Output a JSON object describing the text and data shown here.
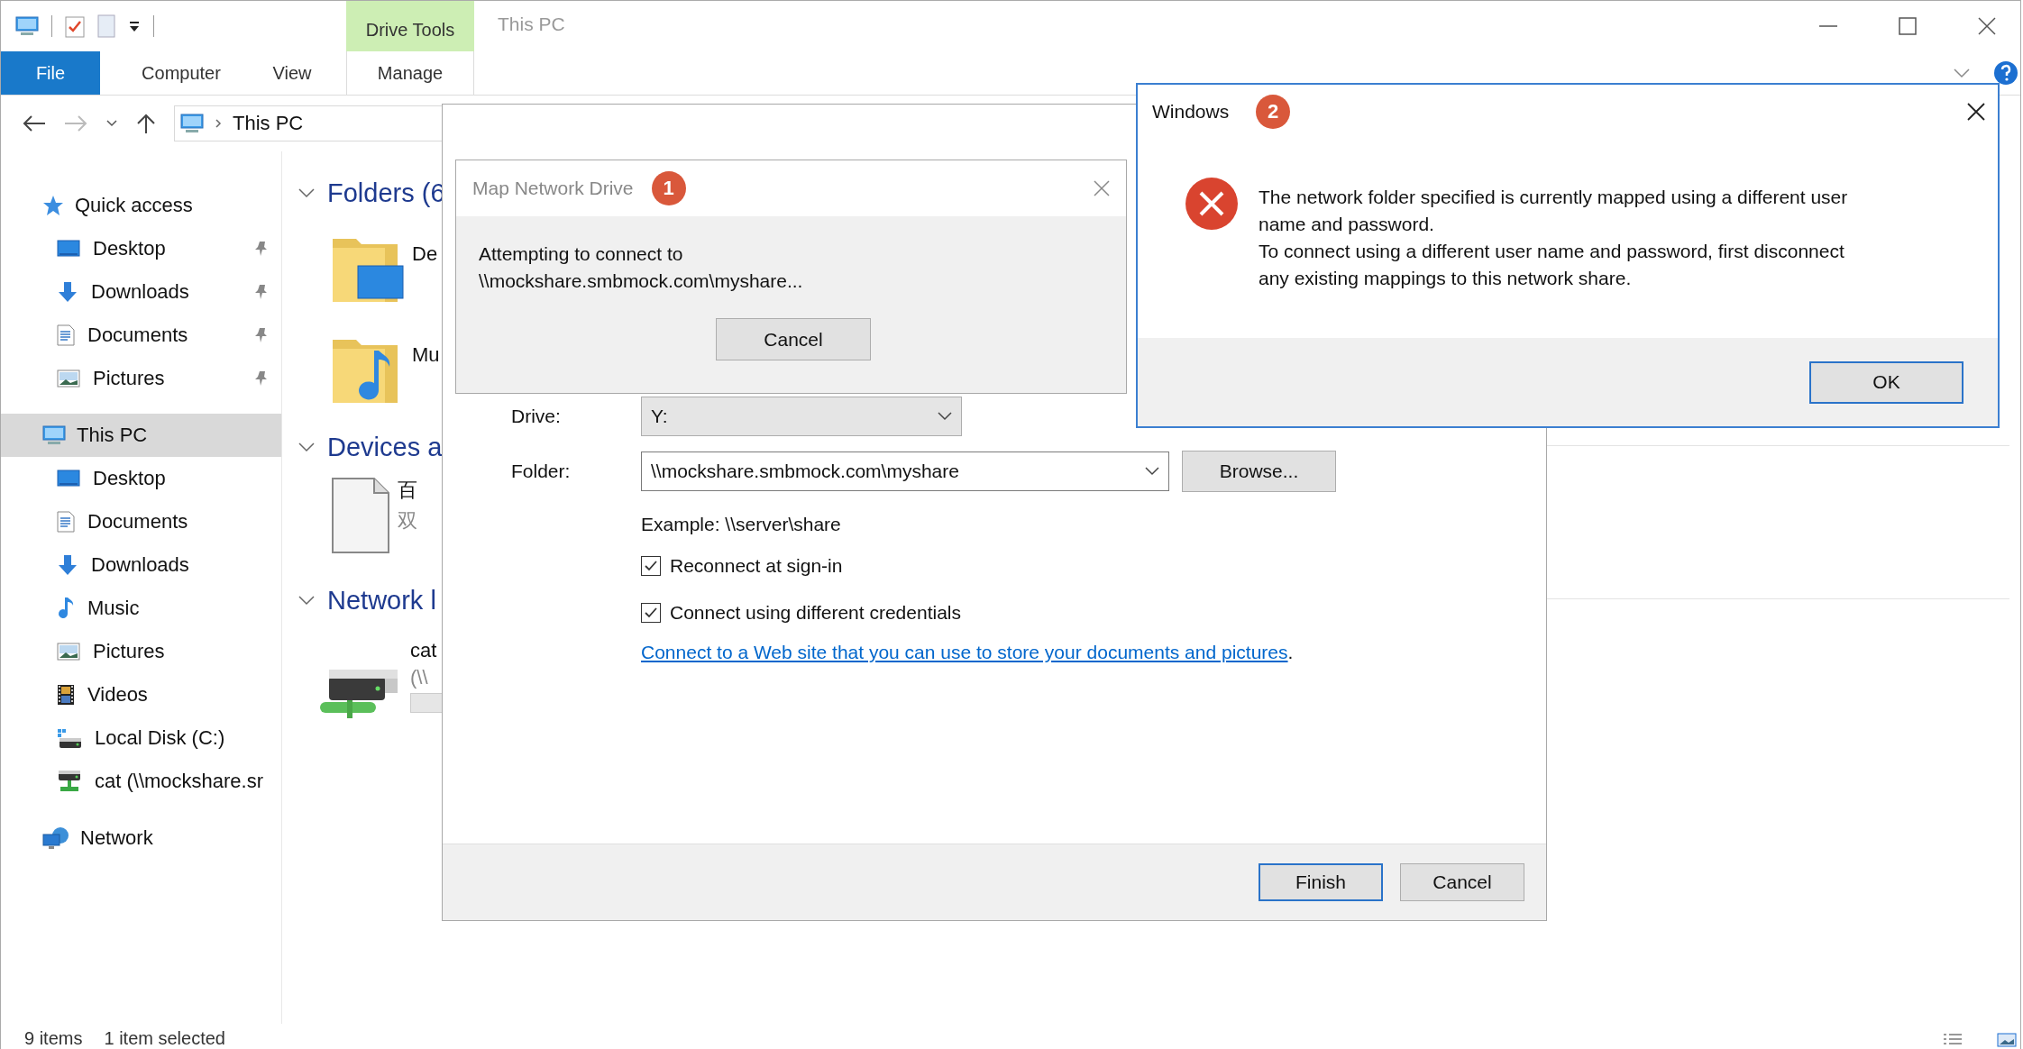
{
  "window": {
    "title": "This PC"
  },
  "contextual_tab": {
    "label": "Drive Tools"
  },
  "ribbon_tabs": [
    {
      "label": "File",
      "kind": "file"
    },
    {
      "label": "Computer",
      "kind": "tab"
    },
    {
      "label": "View",
      "kind": "tab"
    },
    {
      "label": "Manage",
      "kind": "contextual"
    }
  ],
  "address_bar": {
    "path": "This PC"
  },
  "sidebar": {
    "items": [
      {
        "label": "Quick access",
        "kind": "star",
        "selected": false,
        "children": [
          {
            "label": "Desktop",
            "kind": "desktop",
            "pinned": true
          },
          {
            "label": "Downloads",
            "kind": "downloads",
            "pinned": true
          },
          {
            "label": "Documents",
            "kind": "documents",
            "pinned": true
          },
          {
            "label": "Pictures",
            "kind": "pictures",
            "pinned": true
          }
        ]
      },
      {
        "label": "This PC",
        "kind": "pc",
        "selected": true,
        "children": [
          {
            "label": "Desktop",
            "kind": "desktop",
            "pinned": false
          },
          {
            "label": "Documents",
            "kind": "documents",
            "pinned": false
          },
          {
            "label": "Downloads",
            "kind": "downloads",
            "pinned": false
          },
          {
            "label": "Music",
            "kind": "music",
            "pinned": false
          },
          {
            "label": "Pictures",
            "kind": "pictures",
            "pinned": false
          },
          {
            "label": "Videos",
            "kind": "videos",
            "pinned": false
          },
          {
            "label": "Local Disk (C:)",
            "kind": "disk",
            "pinned": false
          },
          {
            "label": "cat (\\\\mockshare.sr",
            "kind": "netdrive",
            "pinned": false
          }
        ]
      },
      {
        "label": "Network",
        "kind": "network",
        "selected": false
      }
    ]
  },
  "content": {
    "groups": [
      {
        "title": "Folders (6",
        "items": [
          {
            "name": "De",
            "kind": "desktop-folder"
          },
          {
            "name": "Mu",
            "kind": "music-folder"
          }
        ]
      },
      {
        "title": "Devices a",
        "items": [
          {
            "name": "百",
            "detail": "双",
            "kind": "file"
          }
        ]
      },
      {
        "title": "Network l",
        "items": [
          {
            "name": "cat",
            "detail": "(\\\\",
            "kind": "netdrive"
          }
        ]
      }
    ]
  },
  "status_bar": {
    "items": [
      "9 items",
      "1 item selected"
    ]
  },
  "map_dialog": {
    "drive_label": "Drive:",
    "drive": "Y:",
    "folder_label": "Folder:",
    "folder": "\\\\mockshare.smbmock.com\\myshare",
    "browse": "Browse...",
    "example": "Example: \\\\server\\share",
    "options": [
      {
        "label": "Reconnect at sign-in",
        "checked": true
      },
      {
        "label": "Connect using different credentials",
        "checked": true
      }
    ],
    "link": "Connect to a Web site that you can use to store your documents and pictures",
    "link_tail": ".",
    "buttons": [
      {
        "label": "Finish",
        "default": true
      },
      {
        "label": "Cancel",
        "default": false
      }
    ]
  },
  "progress_dialog": {
    "title": "Map Network Drive",
    "badge": "1",
    "message": "Attempting to connect to\n\\\\mockshare.smbmock.com\\myshare...",
    "button": "Cancel"
  },
  "error_dialog": {
    "title": "Windows",
    "badge": "2",
    "message": [
      "The network folder specified is currently mapped using a different user\nname and password.",
      "To connect using a different user name and password, first disconnect\nany existing mappings to this network share."
    ],
    "button": {
      "label": "OK",
      "default": true
    }
  }
}
